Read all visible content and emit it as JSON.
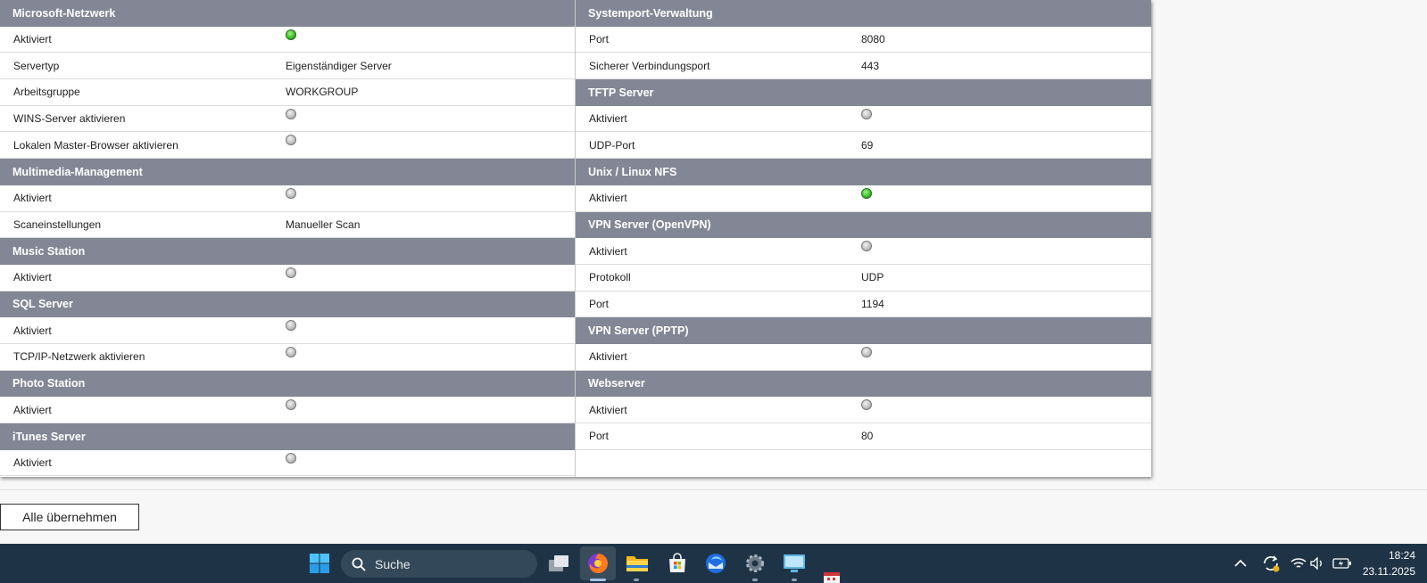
{
  "left_sections": [
    {
      "title": "Microsoft-Netzwerk",
      "rows": [
        {
          "label": "Aktiviert",
          "type": "led",
          "status": "on"
        },
        {
          "label": "Servertyp",
          "type": "text",
          "value": "Eigenständiger Server"
        },
        {
          "label": "Arbeitsgruppe",
          "type": "text",
          "value": "WORKGROUP"
        },
        {
          "label": "WINS-Server aktivieren",
          "type": "led",
          "status": "off"
        },
        {
          "label": "Lokalen Master-Browser aktivieren",
          "type": "led",
          "status": "off"
        }
      ]
    },
    {
      "title": "Multimedia-Management",
      "rows": [
        {
          "label": "Aktiviert",
          "type": "led",
          "status": "off"
        },
        {
          "label": "Scaneinstellungen",
          "type": "text",
          "value": "Manueller Scan"
        }
      ]
    },
    {
      "title": "Music Station",
      "rows": [
        {
          "label": "Aktiviert",
          "type": "led",
          "status": "off"
        }
      ]
    },
    {
      "title": "SQL Server",
      "rows": [
        {
          "label": "Aktiviert",
          "type": "led",
          "status": "off"
        },
        {
          "label": "TCP/IP-Netzwerk aktivieren",
          "type": "led",
          "status": "off"
        }
      ]
    },
    {
      "title": "Photo Station",
      "rows": [
        {
          "label": "Aktiviert",
          "type": "led",
          "status": "off"
        }
      ]
    },
    {
      "title": "iTunes Server",
      "rows": [
        {
          "label": "Aktiviert",
          "type": "led",
          "status": "off"
        }
      ]
    }
  ],
  "right_sections": [
    {
      "title": "Systemport-Verwaltung",
      "rows": [
        {
          "label": "Port",
          "type": "text",
          "value": "8080"
        },
        {
          "label": "Sicherer Verbindungsport",
          "type": "text",
          "value": "443"
        }
      ]
    },
    {
      "title": "TFTP Server",
      "rows": [
        {
          "label": "Aktiviert",
          "type": "led",
          "status": "off"
        },
        {
          "label": "UDP-Port",
          "type": "text",
          "value": "69"
        }
      ]
    },
    {
      "title": "Unix / Linux NFS",
      "rows": [
        {
          "label": "Aktiviert",
          "type": "led",
          "status": "on"
        }
      ]
    },
    {
      "title": "VPN Server (OpenVPN)",
      "rows": [
        {
          "label": "Aktiviert",
          "type": "led",
          "status": "off"
        },
        {
          "label": "Protokoll",
          "type": "text",
          "value": "UDP"
        },
        {
          "label": "Port",
          "type": "text",
          "value": "1194"
        }
      ]
    },
    {
      "title": "VPN Server (PPTP)",
      "rows": [
        {
          "label": "Aktiviert",
          "type": "led",
          "status": "off"
        }
      ]
    },
    {
      "title": "Webserver",
      "rows": [
        {
          "label": "Aktiviert",
          "type": "led",
          "status": "off"
        },
        {
          "label": "Port",
          "type": "text",
          "value": "80"
        }
      ]
    }
  ],
  "apply_button_label": "Alle übernehmen",
  "taskbar": {
    "search_placeholder": "Suche",
    "time": "18:24",
    "date": "23.11.2025",
    "icons": [
      "windows-start-icon",
      "search-icon",
      "task-view-icon",
      "firefox-icon",
      "file-explorer-icon",
      "microsoft-store-icon",
      "thunderbird-icon",
      "settings-icon",
      "remote-desktop-icon",
      "calendar-icon"
    ]
  },
  "colors": {
    "section_header": "#838795",
    "led_on": "#3fbf2a",
    "led_off": "#bdbdbd",
    "taskbar": "#1e3446"
  }
}
